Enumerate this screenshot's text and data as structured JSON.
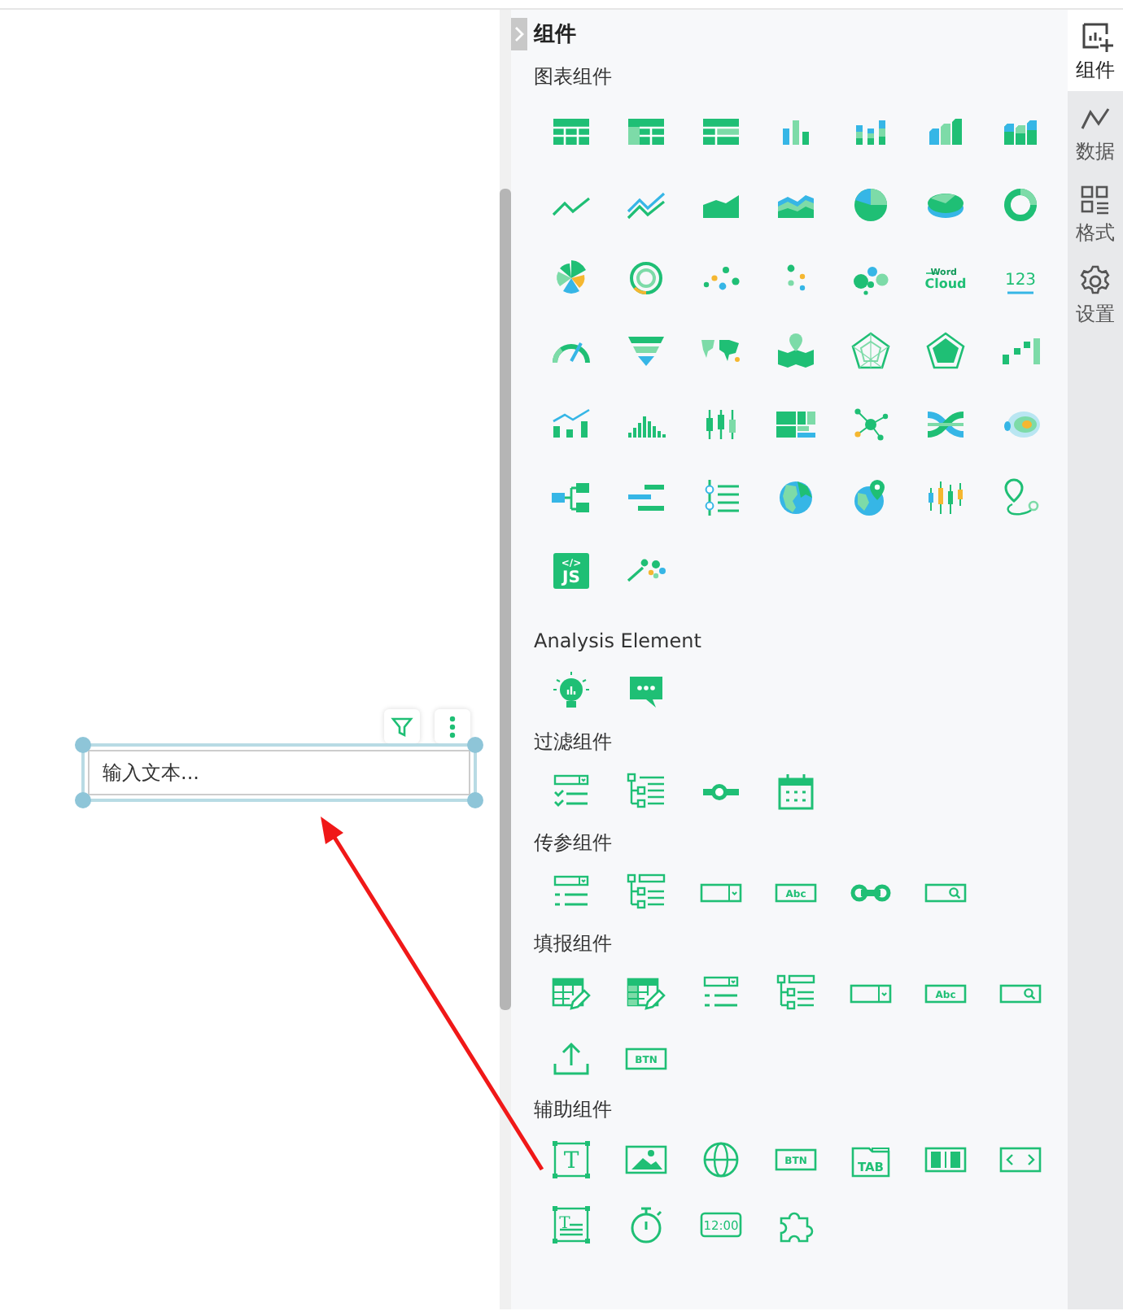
{
  "canvas": {
    "widget": {
      "placeholder": "输入文本..."
    }
  },
  "panel": {
    "title": "组件",
    "sections": [
      {
        "title": "图表组件",
        "items": [
          {
            "kind": "table"
          },
          {
            "kind": "tableFrozen"
          },
          {
            "kind": "tableGroup"
          },
          {
            "kind": "bar"
          },
          {
            "kind": "stackedBar"
          },
          {
            "kind": "bar3d"
          },
          {
            "kind": "stackedBar3d"
          },
          {
            "kind": "line"
          },
          {
            "kind": "multiLine"
          },
          {
            "kind": "area"
          },
          {
            "kind": "stackedArea"
          },
          {
            "kind": "pie"
          },
          {
            "kind": "pie3d"
          },
          {
            "kind": "donut"
          },
          {
            "kind": "rose"
          },
          {
            "kind": "ring"
          },
          {
            "kind": "scatter"
          },
          {
            "kind": "dots"
          },
          {
            "kind": "bubble"
          },
          {
            "kind": "wordcloud",
            "labels": [
              "Word",
              "Cloud"
            ]
          },
          {
            "kind": "number",
            "labels": [
              "123"
            ]
          },
          {
            "kind": "gauge"
          },
          {
            "kind": "funnel"
          },
          {
            "kind": "worldMap"
          },
          {
            "kind": "mapPin"
          },
          {
            "kind": "radarLine"
          },
          {
            "kind": "radar"
          },
          {
            "kind": "stepBars"
          },
          {
            "kind": "combo"
          },
          {
            "kind": "histogram"
          },
          {
            "kind": "boxplot"
          },
          {
            "kind": "treemap"
          },
          {
            "kind": "network"
          },
          {
            "kind": "sankey"
          },
          {
            "kind": "heatmap"
          },
          {
            "kind": "orgTree"
          },
          {
            "kind": "gantt"
          },
          {
            "kind": "timeline"
          },
          {
            "kind": "globe"
          },
          {
            "kind": "globePin"
          },
          {
            "kind": "candlestick"
          },
          {
            "kind": "route"
          },
          {
            "kind": "js",
            "labels": [
              "</>",
              "JS"
            ]
          },
          {
            "kind": "magic"
          }
        ]
      },
      {
        "title": "Analysis Element",
        "items": [
          {
            "kind": "bulb"
          },
          {
            "kind": "chat"
          }
        ]
      },
      {
        "title": "过滤组件",
        "items": [
          {
            "kind": "checklist"
          },
          {
            "kind": "treeList"
          },
          {
            "kind": "slider"
          },
          {
            "kind": "calendar"
          }
        ]
      },
      {
        "title": "传参组件",
        "items": [
          {
            "kind": "dropdownList"
          },
          {
            "kind": "treeList2"
          },
          {
            "kind": "comboBox"
          },
          {
            "kind": "textbox",
            "labels": [
              "Abc"
            ]
          },
          {
            "kind": "rangeSlider"
          },
          {
            "kind": "searchBox"
          }
        ]
      },
      {
        "title": "填报组件",
        "items": [
          {
            "kind": "tableEdit"
          },
          {
            "kind": "tableEdit2"
          },
          {
            "kind": "dropdownList"
          },
          {
            "kind": "treeList2"
          },
          {
            "kind": "comboBox"
          },
          {
            "kind": "textbox",
            "labels": [
              "Abc"
            ]
          },
          {
            "kind": "searchBox"
          },
          {
            "kind": "upload"
          },
          {
            "kind": "button",
            "labels": [
              "BTN"
            ]
          }
        ]
      },
      {
        "title": "辅助组件",
        "items": [
          {
            "kind": "text",
            "labels": [
              "T"
            ]
          },
          {
            "kind": "image"
          },
          {
            "kind": "web"
          },
          {
            "kind": "button",
            "labels": [
              "BTN"
            ]
          },
          {
            "kind": "tab",
            "labels": [
              "TAB"
            ]
          },
          {
            "kind": "carousel"
          },
          {
            "kind": "pager"
          },
          {
            "kind": "richText",
            "labels": [
              "T"
            ]
          },
          {
            "kind": "timer"
          },
          {
            "kind": "clock",
            "labels": [
              "12:00"
            ]
          },
          {
            "kind": "puzzle"
          }
        ]
      }
    ]
  },
  "side_tabs": [
    {
      "label": "组件",
      "kind": "components",
      "selected": true
    },
    {
      "label": "数据",
      "kind": "data",
      "selected": false
    },
    {
      "label": "格式",
      "kind": "format",
      "selected": false
    },
    {
      "label": "设置",
      "kind": "settings",
      "selected": false
    }
  ]
}
